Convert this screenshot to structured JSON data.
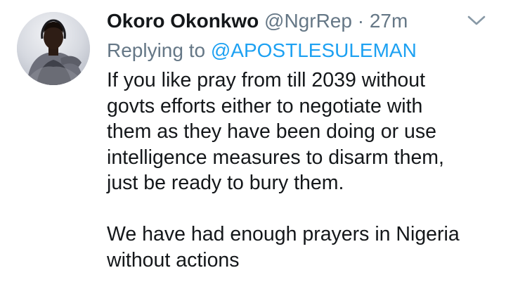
{
  "tweet": {
    "display_name": "Okoro Okonkwo",
    "handle": "@NgrRep",
    "separator": "·",
    "time": "27m",
    "replying_prefix": "Replying to",
    "replying_to": "@APOSTLESULEMAN",
    "paragraph1": [
      "If you like pray from till 2039 without",
      "govts efforts either to negotiate with",
      "them as they have been doing or use",
      "intelligence measures to disarm them,",
      "just be ready to bury them."
    ],
    "paragraph2": [
      "We have had enough prayers in Nigeria",
      "without actions"
    ]
  },
  "icons": {
    "avatar": "profile-photo",
    "menu": "chevron-down-icon"
  },
  "colors": {
    "text": "#14171a",
    "secondary": "#657786",
    "link": "#1da1f2"
  }
}
